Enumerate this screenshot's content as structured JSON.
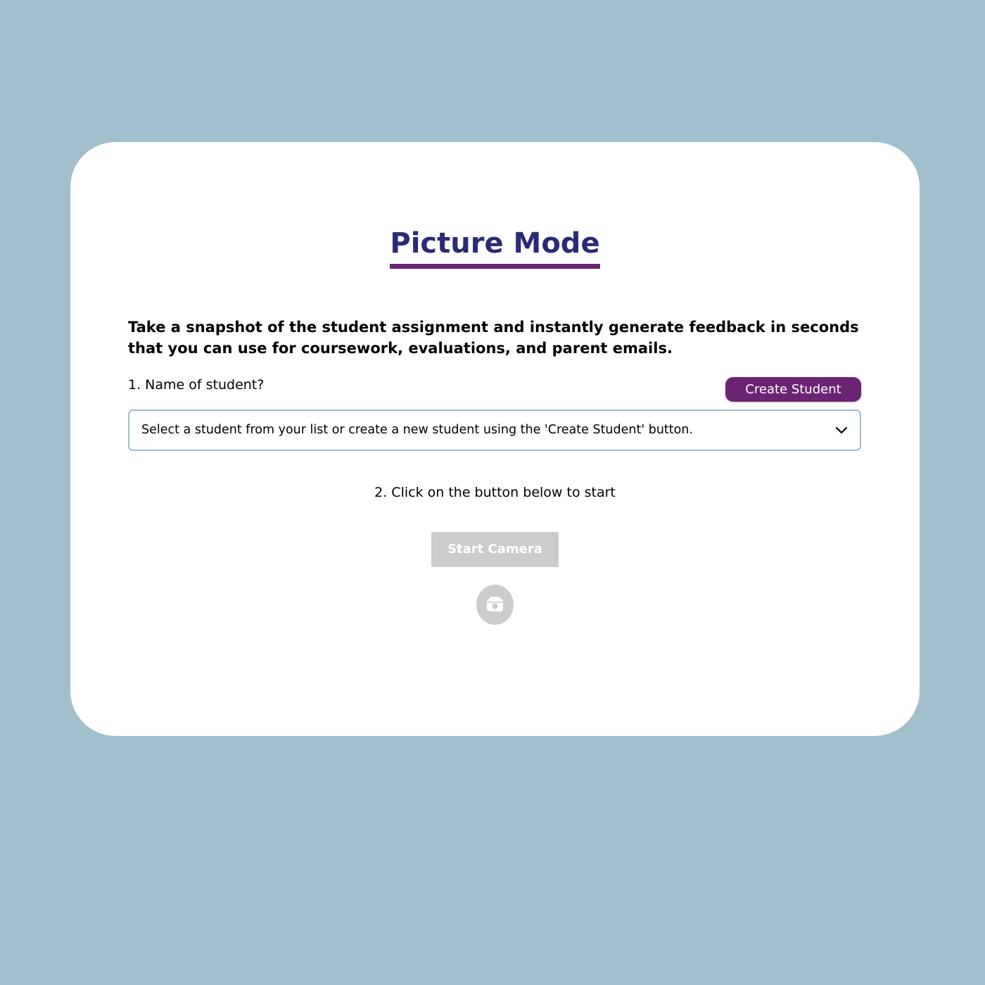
{
  "page": {
    "title": "Picture Mode",
    "intro": "Take a snapshot of the student assignment and instantly generate feedback in seconds that you can use for coursework, evaluations, and parent emails."
  },
  "step1": {
    "label": "1. Name of student?",
    "create_button": "Create Student",
    "select_placeholder": "Select a student from your list or create a new student using the 'Create Student' button.",
    "select_icon": "chevron-down-icon"
  },
  "step2": {
    "label": "2. Click on the button below to start",
    "start_button": "Start Camera",
    "camera_icon": "camera-icon",
    "start_button_state": "disabled"
  },
  "colors": {
    "background": "#a1bfcd",
    "title": "#2b2a78",
    "accent": "#6b2473",
    "disabled": "#cccccc",
    "select_border": "#9fbdcb"
  }
}
